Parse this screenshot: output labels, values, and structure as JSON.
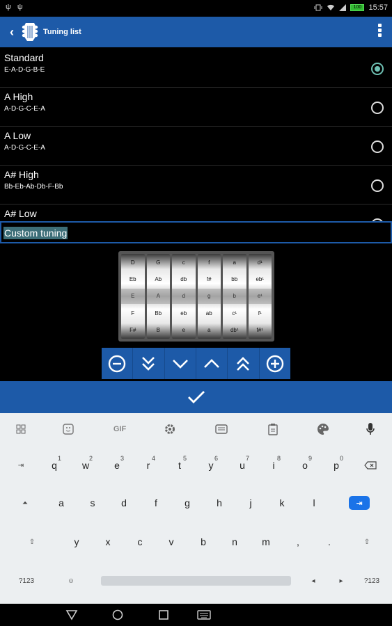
{
  "status": {
    "left_icons": "ψ ψ",
    "time": "15:57",
    "battery": "100"
  },
  "appbar": {
    "title": "Tuning list",
    "back_icon": "chevron-left-icon",
    "logo_icon": "guitar-headstock-icon",
    "menu_icon": "overflow-menu-icon"
  },
  "tunings": [
    {
      "name": "Standard",
      "notes": "E-A-D-G-B-E",
      "selected": true
    },
    {
      "name": "A High",
      "notes": "A-D-G-C-E-A",
      "selected": false
    },
    {
      "name": "A Low",
      "notes": "A-D-G-C-E-A",
      "selected": false
    },
    {
      "name": "A# High",
      "notes": "Bb-Eb-Ab-Db-F-Bb",
      "selected": false
    },
    {
      "name": "A# Low",
      "notes": "",
      "selected": false
    }
  ],
  "input": {
    "value": "Custom tuning"
  },
  "drum": {
    "columns": [
      [
        "D",
        "Eb",
        "E",
        "F",
        "F#"
      ],
      [
        "G",
        "Ab",
        "A",
        "Bb",
        "B"
      ],
      [
        "c",
        "db",
        "d",
        "eb",
        "e"
      ],
      [
        "f",
        "f#",
        "g",
        "ab",
        "a"
      ],
      [
        "a",
        "bb",
        "b",
        "c¹",
        "db¹"
      ],
      [
        "d¹",
        "eb¹",
        "e¹",
        "f¹",
        "f#¹"
      ]
    ]
  },
  "controls": [
    "minus-circle-icon",
    "double-chevron-down-icon",
    "chevron-down-icon",
    "chevron-up-icon",
    "double-chevron-up-icon",
    "plus-circle-icon"
  ],
  "keyboard": {
    "toolbar": {
      "gif": "GIF"
    },
    "row1": [
      {
        "k": "q",
        "n": "1"
      },
      {
        "k": "w",
        "n": "2"
      },
      {
        "k": "e",
        "n": "3"
      },
      {
        "k": "r",
        "n": "4"
      },
      {
        "k": "t",
        "n": "5"
      },
      {
        "k": "y",
        "n": "6"
      },
      {
        "k": "u",
        "n": "7"
      },
      {
        "k": "i",
        "n": "8"
      },
      {
        "k": "o",
        "n": "9"
      },
      {
        "k": "p",
        "n": "0"
      }
    ],
    "row2": [
      "a",
      "s",
      "d",
      "f",
      "g",
      "h",
      "j",
      "k",
      "l"
    ],
    "row3": [
      "y",
      "x",
      "c",
      "v",
      "b",
      "n",
      "m",
      ",",
      "."
    ],
    "sym_left": "?123",
    "sym_right": "?123"
  },
  "colors": {
    "primary": "#1d5aa8",
    "radio_on": "#6ec0b3",
    "key_accent": "#1a73e8"
  }
}
